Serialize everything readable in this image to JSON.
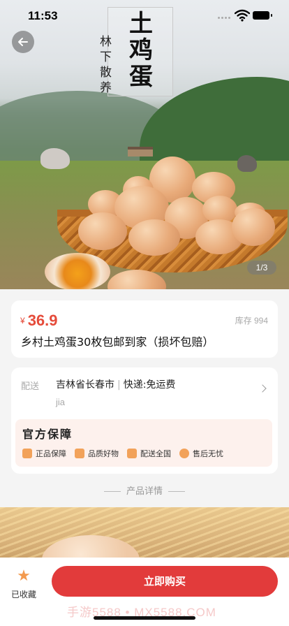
{
  "status_bar": {
    "time": "11:53"
  },
  "hero": {
    "title_big": "土鸡蛋",
    "title_small": "林下散养",
    "image_indicator": "1/3"
  },
  "product": {
    "currency": "¥",
    "price": "36.9",
    "stock": "库存 994",
    "title": "乡村土鸡蛋30枚包邮到家（损坏包赔）"
  },
  "shipping": {
    "label": "配送",
    "location": "吉林省长春市",
    "method": "快递:免运费",
    "sub": "jia"
  },
  "guarantee": {
    "title": "官方保障",
    "items": [
      {
        "label": "正品保障",
        "icon": "shield-icon"
      },
      {
        "label": "品质好物",
        "icon": "crown-icon"
      },
      {
        "label": "配送全国",
        "icon": "truck-icon"
      },
      {
        "label": "售后无忧",
        "icon": "service-icon"
      }
    ]
  },
  "detail_divider": "产品详情",
  "bottom_bar": {
    "favorite_label": "已收藏",
    "buy_label": "立即购买",
    "watermark": "手游5588 • MX5588.COM"
  },
  "colors": {
    "accent": "#e23b3b",
    "price": "#e54b3a",
    "guarantee_bg": "#fdf1ed",
    "icon": "#f39a4e"
  }
}
